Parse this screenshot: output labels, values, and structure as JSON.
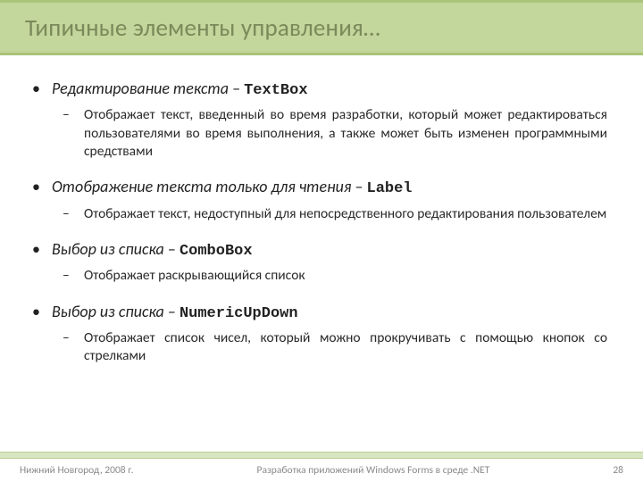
{
  "header": {
    "title": "Типичные элементы управления…"
  },
  "items": [
    {
      "lead": "Редактирование текста",
      "sep": " – ",
      "ctrl": "TextBox",
      "sub": "Отображает текст, введенный во время разработки, который может редактироваться пользователями во время выполнения, а также может быть изменен программными средствами"
    },
    {
      "lead": "Отображение текста только для чтения",
      "sep": " – ",
      "ctrl": "Label",
      "sub": "Отображает текст, недоступный для непосредственного редактирования пользователем"
    },
    {
      "lead": "Выбор из списка",
      "sep": " – ",
      "ctrl": "ComboBox",
      "sub": "Отображает раскрывающийся список"
    },
    {
      "lead": "Выбор из списка",
      "sep": " – ",
      "ctrl": "NumericUpDown",
      "sub": "Отображает список чисел, который можно прокручивать с помощью кнопок со стрелками"
    }
  ],
  "footer": {
    "left": "Нижний Новгород, 2008 г.",
    "center": "Разработка приложений Windows Forms в среде .NET",
    "page": "28"
  }
}
